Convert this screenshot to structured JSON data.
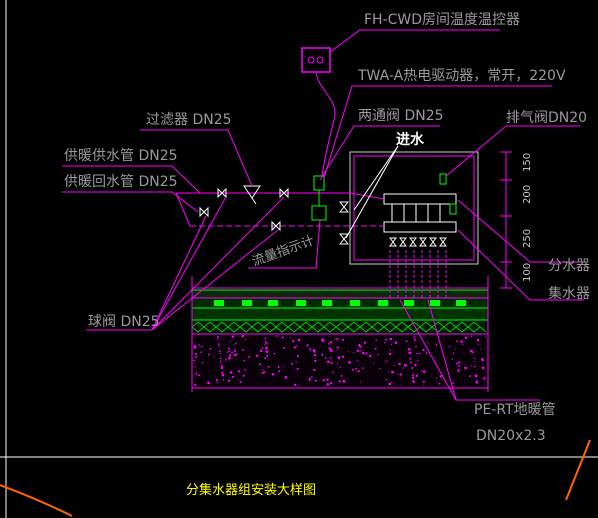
{
  "title": "分集水器组安装大样图",
  "labels": {
    "thermostat": "FH-CWD房间温度温控器",
    "actuator": "TWA-A热电驱动器，常开，220V",
    "two_way_valve": "两通阀 DN25",
    "inlet": "进水",
    "vent_valve": "排气阀DN20",
    "filter": "过滤器 DN25",
    "supply_pipe": "供暖供水管 DN25",
    "return_pipe": "供暖回水管 DN25",
    "flow_meter": "流量指示计",
    "ball_valve": "球阀 DN25",
    "distributor": "分水器",
    "collector": "集水器",
    "pipe_spec_1": "PE-RT地暖管",
    "pipe_spec_2": "DN20x2.3"
  },
  "dimensions": [
    "150",
    "200",
    "250",
    "100"
  ],
  "colors": {
    "leader": "#ff00ff",
    "pipe": "#ff00ff",
    "valve": "#ffffff",
    "device": "#00ff00",
    "fill_layer": "#00cc00",
    "title": "#ffff00",
    "curve": "#ff6600"
  }
}
